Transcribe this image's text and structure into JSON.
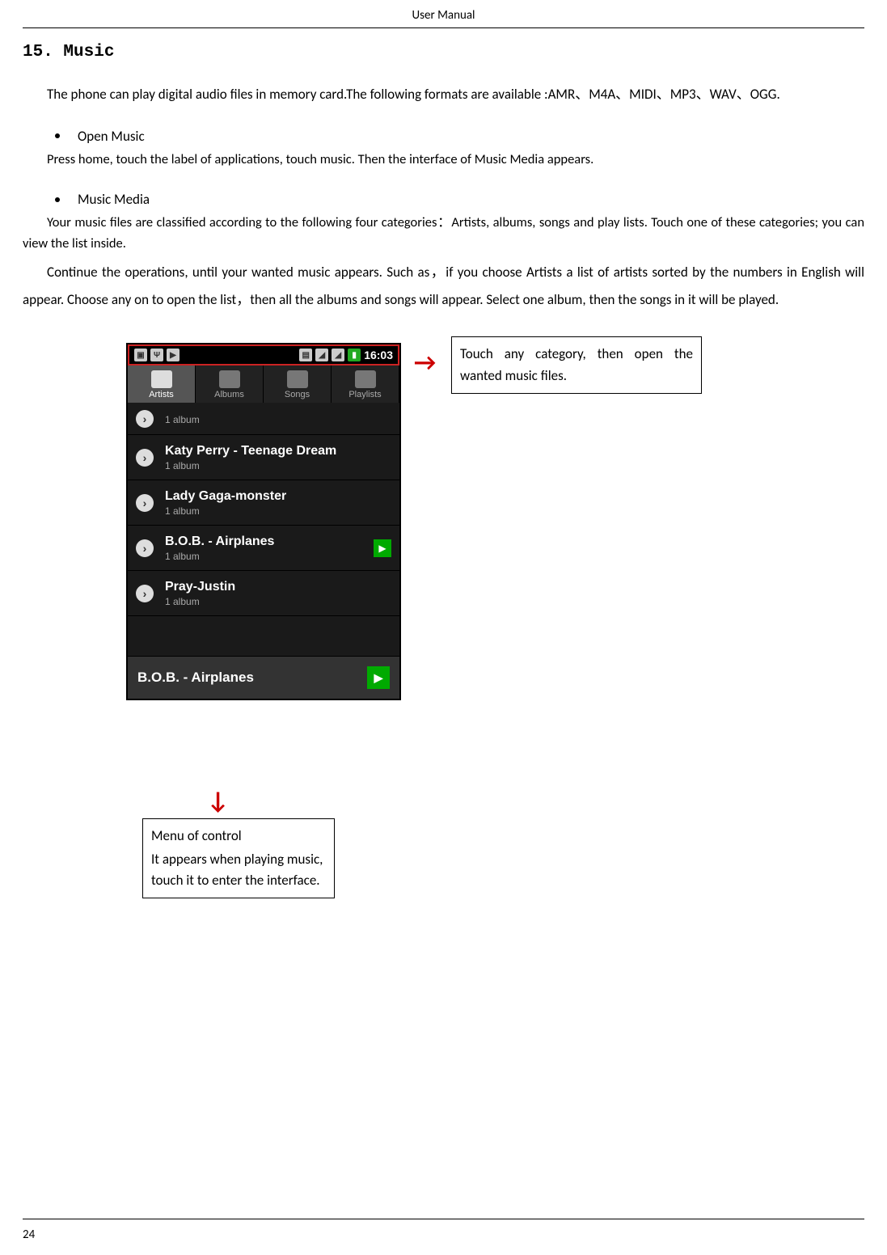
{
  "doc": {
    "header": "User Manual",
    "page_number": "24",
    "section_heading": "15. Music",
    "intro": "The    phone can play digital audio files in memory card.The following formats are available :AMR、M4A、MIDI、MP3、WAV、OGG.",
    "bullets": [
      {
        "title": "Open Music",
        "paras": [
          "Press home, touch the label of applications, touch music. Then the interface of Music Media appears."
        ]
      },
      {
        "title": "Music Media",
        "paras": [
          "Your music files are classified according to the following four categories：Artists, albums, songs and play lists. Touch one of these categories; you can view the list inside.",
          "Continue the operations, until your wanted music appears. Such as，if you choose Artists a list of artists sorted by the numbers in English will appear. Choose any on to open the list，then all the albums and songs will appear. Select one album, then the songs in it will be played."
        ]
      }
    ]
  },
  "callouts": {
    "right": "Touch any category, then open the wanted music files.",
    "bottom_title": "Menu of control",
    "bottom_body": "It appears when playing music, touch it to enter the interface."
  },
  "phone": {
    "time": "16:03",
    "tabs": [
      "Artists",
      "Albums",
      "Songs",
      "Playlists"
    ],
    "active_tab_index": 0,
    "rows": [
      {
        "name": "",
        "sub": "1 album"
      },
      {
        "name": "Katy Perry - Teenage Dream",
        "sub": "1 album"
      },
      {
        "name": "Lady Gaga-monster",
        "sub": "1 album"
      },
      {
        "name": "B.O.B. - Airplanes",
        "sub": "1 album",
        "playing": true
      },
      {
        "name": "Pray-Justin",
        "sub": "1 album"
      }
    ],
    "nowplaying": "B.O.B. - Airplanes"
  }
}
